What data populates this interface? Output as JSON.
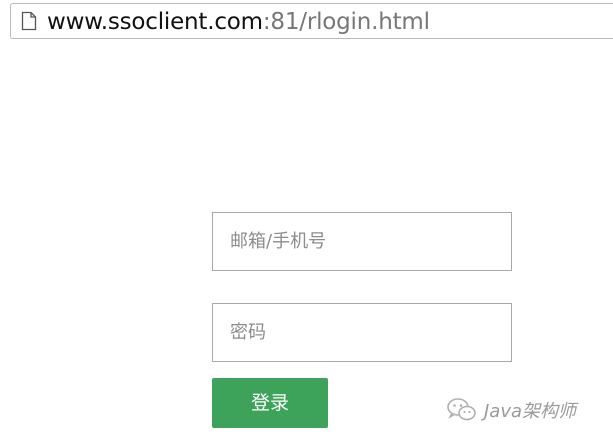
{
  "browser": {
    "icon": "page-icon",
    "url_host": "www.ssoclient.com",
    "url_rest": ":81/rlogin.html"
  },
  "form": {
    "username_placeholder": "邮箱/手机号",
    "password_placeholder": "密码",
    "login_label": "登录",
    "button_color": "#3ea35a"
  },
  "watermark": {
    "icon": "wechat-icon",
    "text": "Java架构师"
  }
}
